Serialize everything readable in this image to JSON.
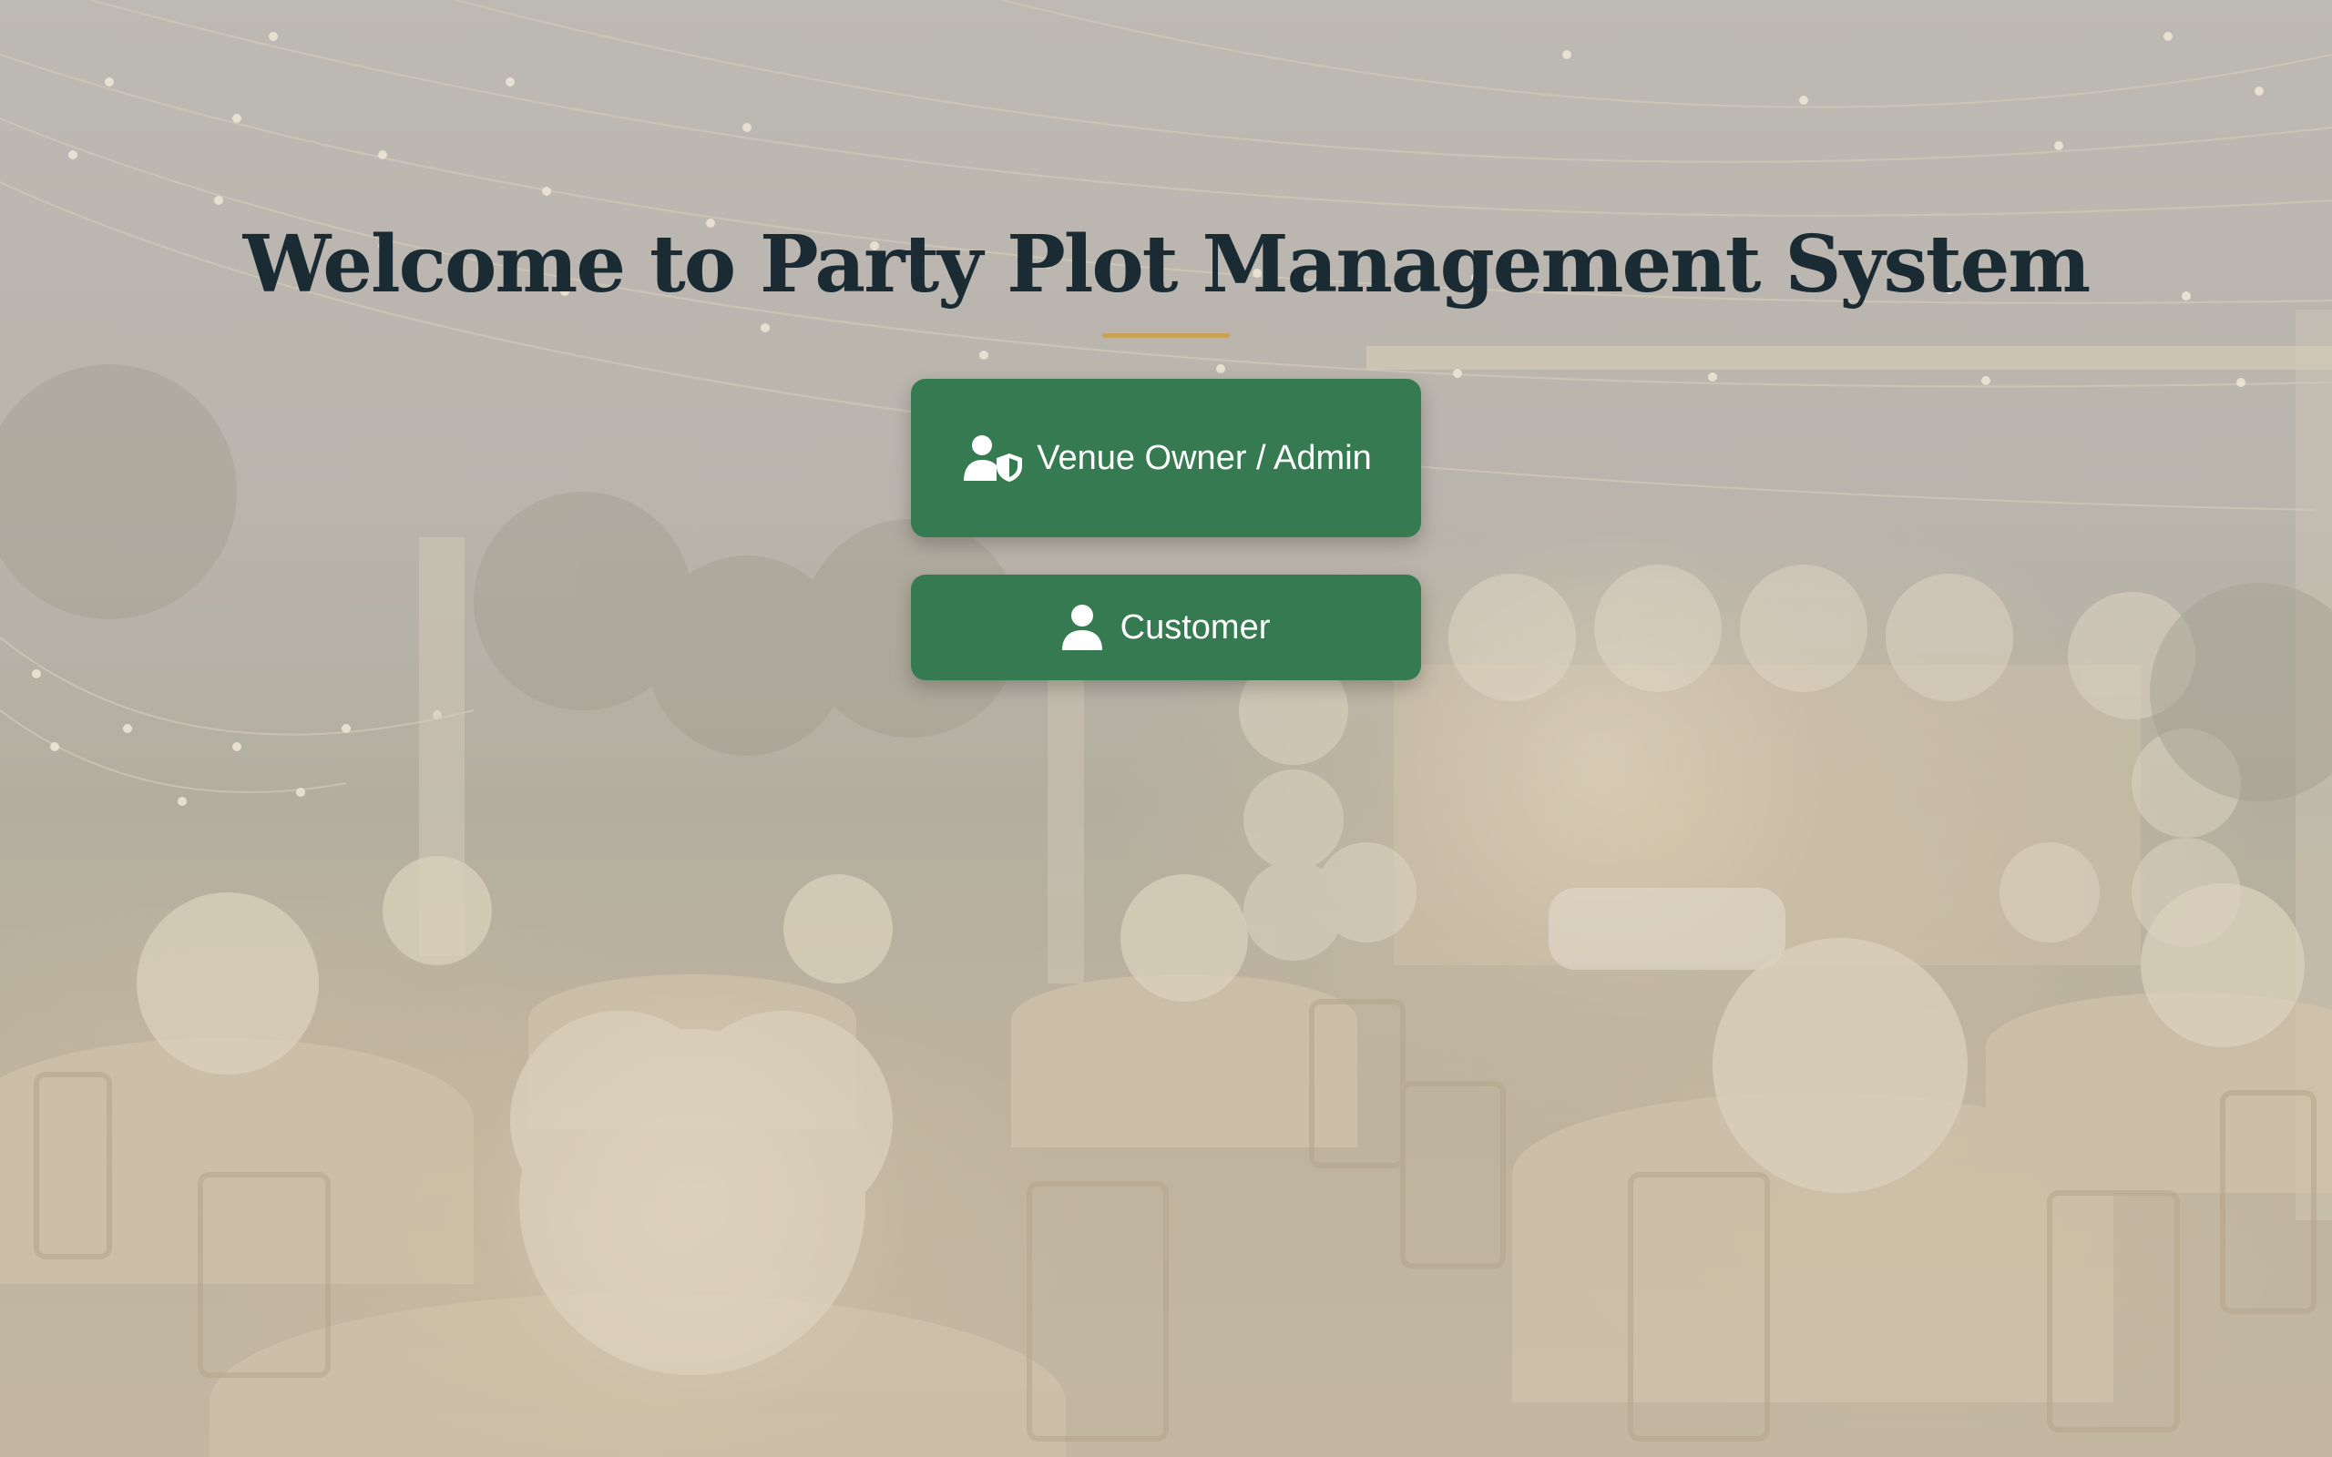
{
  "page": {
    "title": "Welcome to Party Plot Management System"
  },
  "roles": {
    "admin": {
      "label": "Venue Owner / Admin",
      "icon": "user-shield-icon"
    },
    "customer": {
      "label": "Customer",
      "icon": "user-icon"
    }
  },
  "colors": {
    "title": "#1b2b33",
    "accent": "#c9a257",
    "button": "#357a51",
    "button_text": "#ffffff"
  }
}
